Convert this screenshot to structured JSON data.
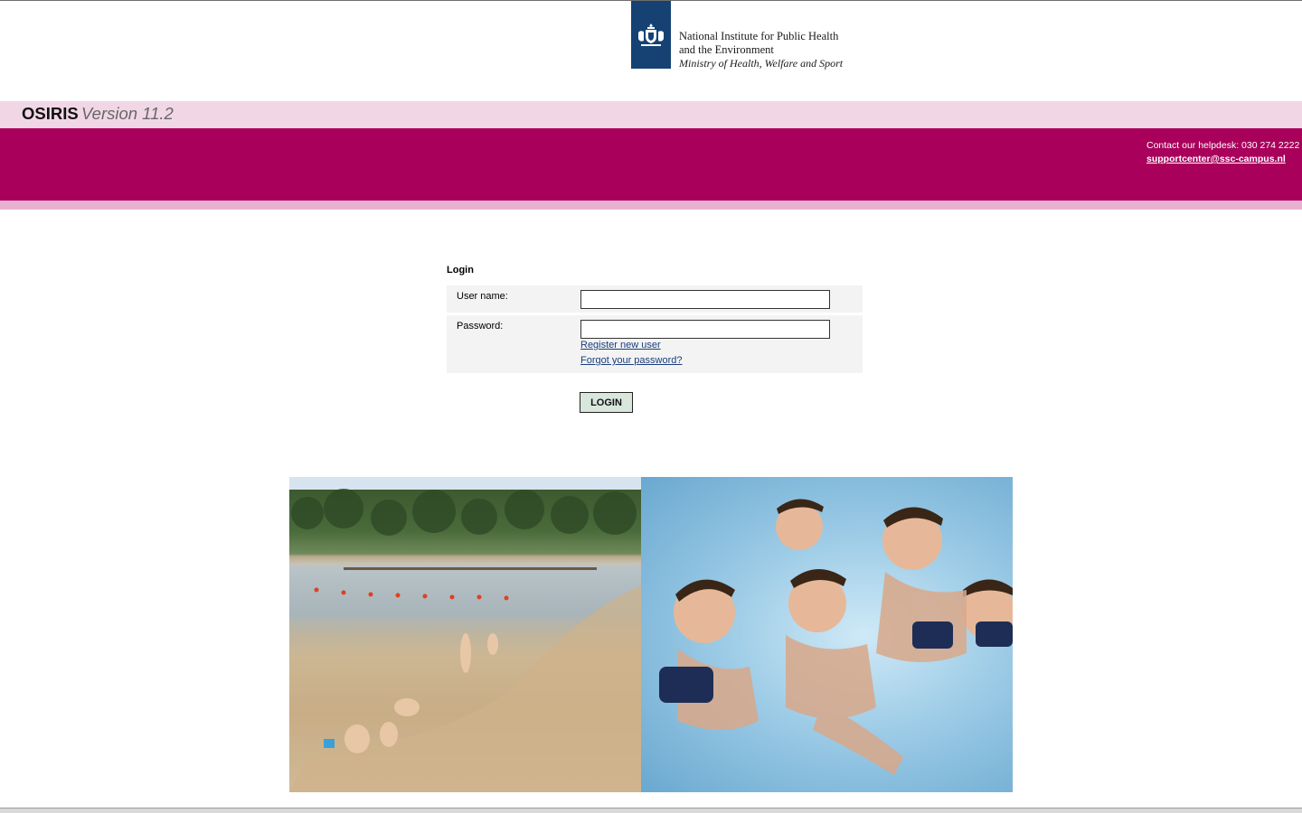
{
  "header": {
    "logo": {
      "line1": "National Institute for Public Health",
      "line2": "and the Environment",
      "line3": "Ministry of Health, Welfare and Sport"
    }
  },
  "titlebar": {
    "app_name": "OSIRIS",
    "version": "Version 11.2"
  },
  "banner": {
    "helpdesk_text": "Contact our helpdesk: 030 274 2222",
    "helpdesk_email": "supportcenter@ssc-campus.nl"
  },
  "login": {
    "title": "Login",
    "username_label": "User name:",
    "username_value": "",
    "password_label": "Password:",
    "password_value": "",
    "register_link": "Register new user",
    "forgot_link": "Forgot your password?",
    "submit_label": "LOGIN"
  },
  "colors": {
    "brand_magenta": "#a8005b",
    "titlebar_pink": "#f1d7e6",
    "logo_blue": "#154273"
  }
}
